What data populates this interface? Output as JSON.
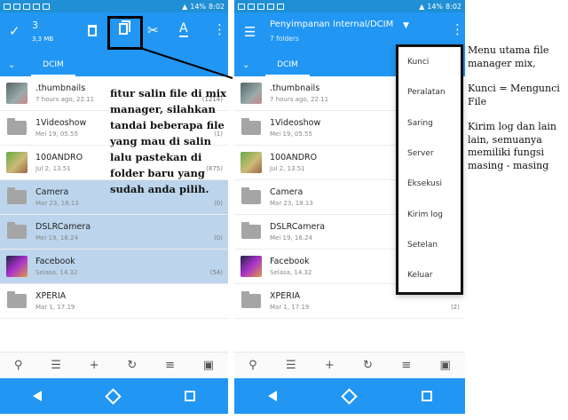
{
  "left": {
    "status_time": "8:02",
    "status_battery": "14%",
    "selection_count": "3",
    "selection_size": "3,3 MB",
    "tab": "DCIM",
    "rows": [
      {
        "name": ".thumbnails",
        "date": "7 hours ago, 22.11",
        "count": "(1214)",
        "thumb": "photo",
        "selected": false
      },
      {
        "name": "1Videoshow",
        "date": "Mei 19, 05.55",
        "count": "(1)",
        "thumb": "folder",
        "selected": false
      },
      {
        "name": "100ANDRO",
        "date": "Jul 2, 13.51",
        "count": "(875)",
        "thumb": "photo2",
        "selected": false
      },
      {
        "name": "Camera",
        "date": "Mar 23, 18.13",
        "count": "(0)",
        "thumb": "folder",
        "selected": true
      },
      {
        "name": "DSLRCamera",
        "date": "Mei 19, 16.24",
        "count": "(0)",
        "thumb": "folder",
        "selected": true
      },
      {
        "name": "Facebook",
        "date": "Selasa, 14.32",
        "count": "(54)",
        "thumb": "photo3",
        "selected": true
      },
      {
        "name": "XPERIA",
        "date": "Mar 1, 17.19",
        "count": "",
        "thumb": "folder",
        "selected": false
      }
    ],
    "annotation": "fitur salin file di mix manager, silahkan tandai beberapa file yang mau di salin lalu pastekan di folder baru yang sudah anda pilih."
  },
  "right": {
    "status_time": "8:02",
    "status_battery": "14%",
    "title": "Penyimpanan Internal/DCIM",
    "subtitle": "7 folders",
    "tab": "DCIM",
    "rows": [
      {
        "name": ".thumbnails",
        "date": "7 hours ago, 22.11",
        "count": "",
        "thumb": "photo"
      },
      {
        "name": "1Videoshow",
        "date": "Mei 19, 05.55",
        "count": "",
        "thumb": "folder"
      },
      {
        "name": "100ANDRO",
        "date": "Jul 2, 13.51",
        "count": "",
        "thumb": "photo2"
      },
      {
        "name": "Camera",
        "date": "Mar 23, 18.13",
        "count": "",
        "thumb": "folder"
      },
      {
        "name": "DSLRCamera",
        "date": "Mei 19, 16.24",
        "count": "",
        "thumb": "folder"
      },
      {
        "name": "Facebook",
        "date": "Selasa, 14.32",
        "count": "",
        "thumb": "photo3"
      },
      {
        "name": "XPERIA",
        "date": "Mar 1, 17.19",
        "count": "(2)",
        "thumb": "folder"
      }
    ],
    "menu": [
      "Kunci",
      "Peralatan",
      "Saring",
      "Server",
      "Eksekusi",
      "Kirim log",
      "Setelan",
      "Keluar"
    ]
  },
  "sidenote": {
    "p1": "Menu utama file manager mix,",
    "p2": "Kunci = Mengunci File",
    "p3": "Kirim log dan lain lain, semuanya memiliki fungsi masing - masing"
  }
}
